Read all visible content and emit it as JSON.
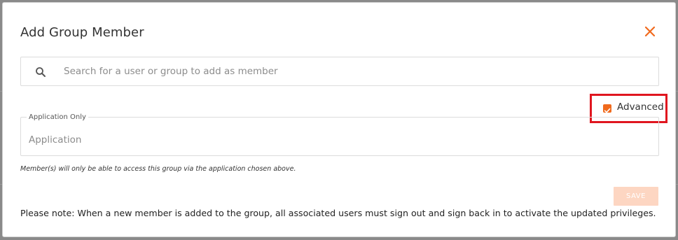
{
  "modal": {
    "title": "Add Group Member",
    "close_icon": "close-icon"
  },
  "search": {
    "icon": "search-icon",
    "placeholder": "Search for a user or group to add as member",
    "value": ""
  },
  "advanced": {
    "label": "Advanced",
    "checked": true,
    "highlight_color": "#e0161f"
  },
  "application": {
    "legend": "Application Only",
    "placeholder": "Application",
    "hint": "Member(s) will only be able to access this group via the application chosen above."
  },
  "actions": {
    "save_label": "SAVE",
    "save_disabled": true
  },
  "note": "Please note: When a new member is added to the group, all associated users must sign out and sign back in to activate the updated privileges.",
  "colors": {
    "accent": "#f06a1d",
    "save_disabled_bg": "#fdd6c2"
  }
}
